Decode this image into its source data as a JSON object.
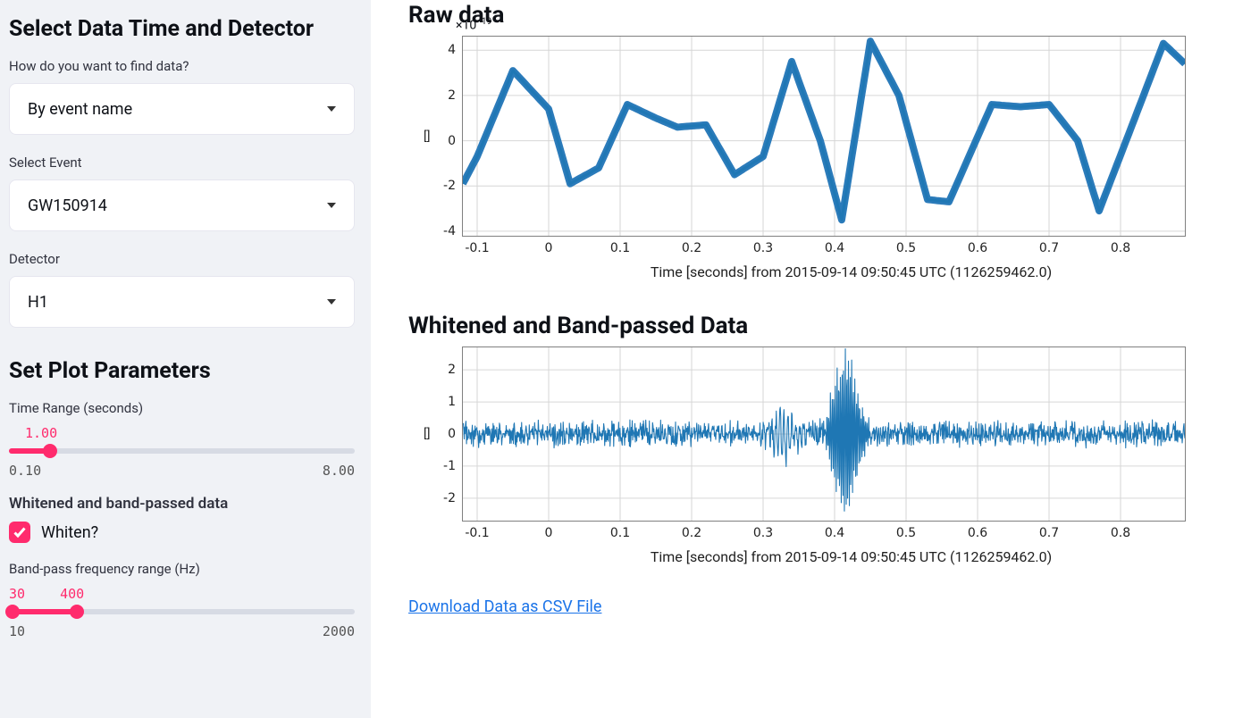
{
  "sidebar": {
    "heading1": "Select Data Time and Detector",
    "find_label": "How do you want to find data?",
    "find_value": "By event name",
    "event_label": "Select Event",
    "event_value": "GW150914",
    "detector_label": "Detector",
    "detector_value": "H1",
    "heading2": "Set Plot Parameters",
    "time_range_label": "Time Range (seconds)",
    "time_range_value": "1.00",
    "time_range_min": "0.10",
    "time_range_max": "8.00",
    "whiten_heading": "Whitened and band-passed data",
    "whiten_checkbox_label": "Whiten?",
    "bp_label": "Band-pass frequency range (Hz)",
    "bp_low_value": "30",
    "bp_high_value": "400",
    "bp_min": "10",
    "bp_max": "2000"
  },
  "main": {
    "raw_title": "Raw data",
    "whitened_title": "Whitened and Band-passed Data",
    "x_axis_label": "Time [seconds] from 2015-09-14 09:50:45 UTC (1126259462.0)",
    "y_axis_label": "[]",
    "download_link": "Download Data as CSV File"
  },
  "chart_data": [
    {
      "type": "line",
      "title": "Raw data",
      "xlabel": "Time [seconds] from 2015-09-14 09:50:45 UTC (1126259462.0)",
      "ylabel": "[]",
      "xlim": [
        -0.12,
        0.89
      ],
      "ylim": [
        -4.2e-19,
        4.6e-19
      ],
      "yscale_text": "×10⁻¹⁹",
      "xticks": [
        -0.1,
        0,
        0.1,
        0.2,
        0.3,
        0.4,
        0.5,
        0.6,
        0.7,
        0.8
      ],
      "yticks": [
        -4,
        -2,
        0,
        2,
        4
      ],
      "x": [
        -0.12,
        -0.1,
        -0.05,
        0.0,
        0.03,
        0.07,
        0.11,
        0.15,
        0.18,
        0.22,
        0.26,
        0.3,
        0.34,
        0.38,
        0.41,
        0.45,
        0.49,
        0.53,
        0.56,
        0.62,
        0.66,
        0.7,
        0.74,
        0.77,
        0.82,
        0.86,
        0.89
      ],
      "y": [
        -1.9e-19,
        -7e-20,
        3.1e-19,
        1.4e-19,
        -1.9e-19,
        -1.2e-19,
        1.6e-19,
        1e-19,
        6e-20,
        7e-20,
        -1.5e-19,
        -7e-20,
        3.5e-19,
        0.0,
        -3.5e-19,
        4.4e-19,
        2e-19,
        -2.6e-19,
        -2.7e-19,
        1.6e-19,
        1.5e-19,
        1.6e-19,
        0.0,
        -3.1e-19,
        1e-19,
        4.3e-19,
        3.4e-19
      ]
    },
    {
      "type": "line",
      "title": "Whitened and Band-passed Data",
      "xlabel": "Time [seconds] from 2015-09-14 09:50:45 UTC (1126259462.0)",
      "ylabel": "[]",
      "xlim": [
        -0.12,
        0.89
      ],
      "ylim": [
        -2.7,
        2.7
      ],
      "xticks": [
        -0.1,
        0,
        0.1,
        0.2,
        0.3,
        0.4,
        0.5,
        0.6,
        0.7,
        0.8
      ],
      "yticks": [
        -2,
        -1,
        0,
        1,
        2
      ],
      "note": "High-frequency whitened strain; burst with peak amplitude ≈ ±2.5 near t ≈ 0.42 s; RMS ≈ 0.5 elsewhere."
    }
  ]
}
